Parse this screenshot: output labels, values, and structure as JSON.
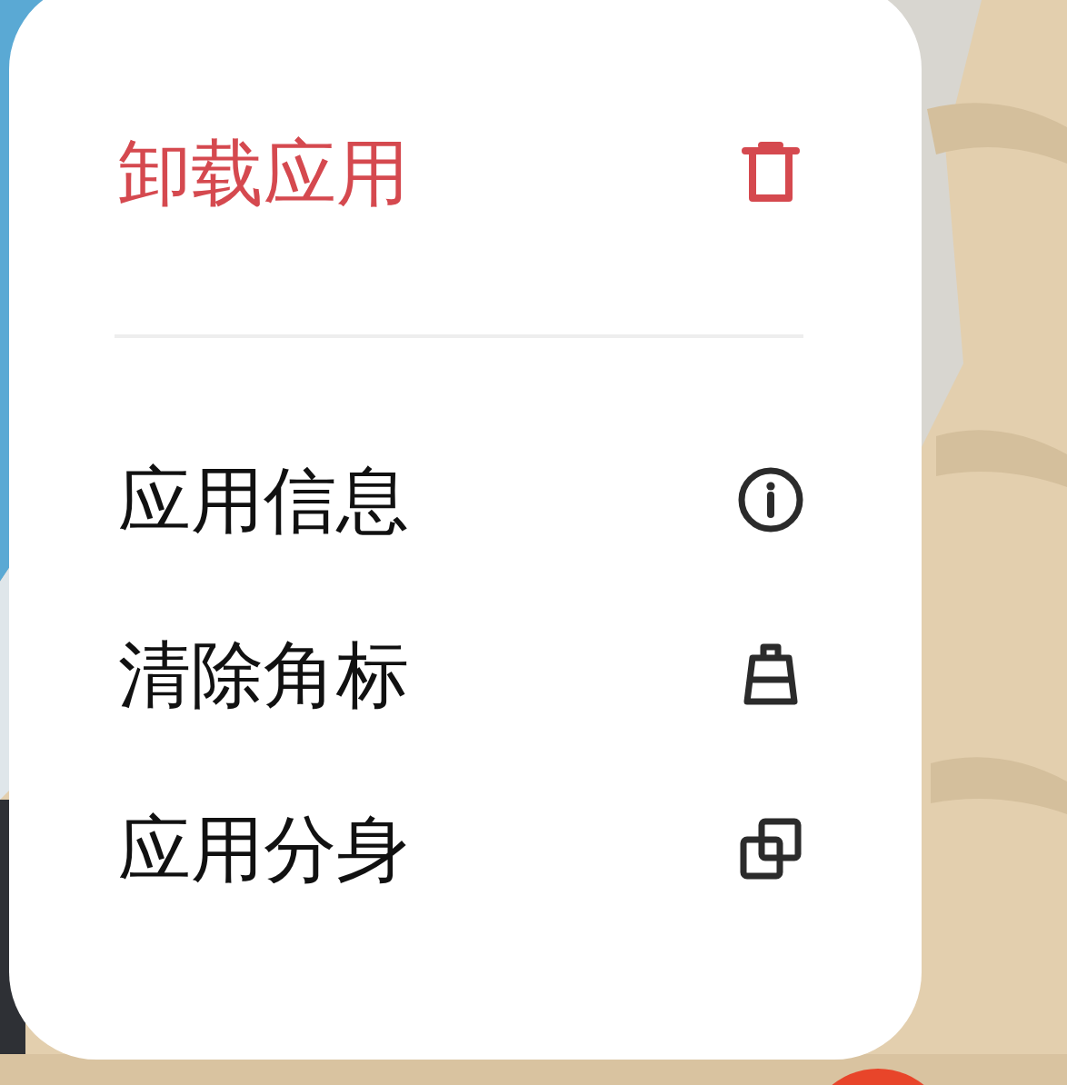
{
  "menu": {
    "items": [
      {
        "label": "卸载应用",
        "kind": "destructive"
      },
      {
        "label": "应用信息",
        "kind": "normal"
      },
      {
        "label": "清除角标",
        "kind": "normal"
      },
      {
        "label": "应用分身",
        "kind": "normal"
      }
    ]
  }
}
